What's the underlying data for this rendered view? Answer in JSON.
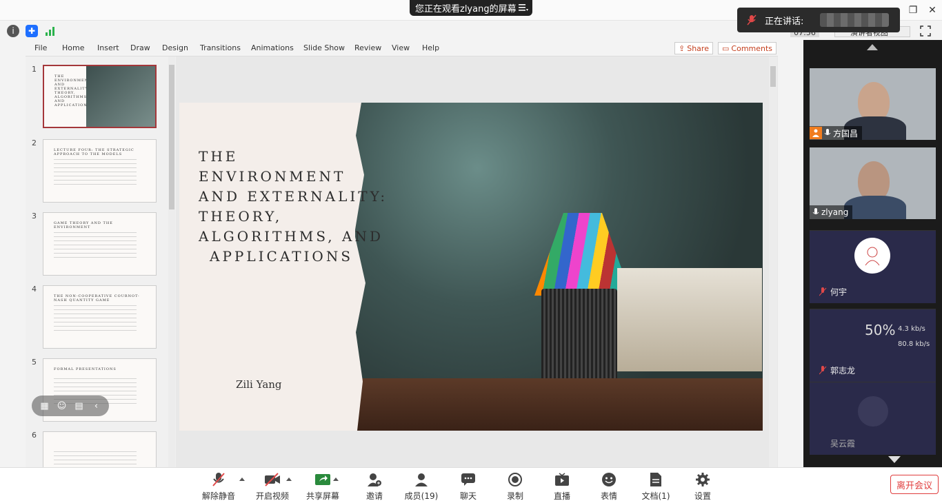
{
  "top": {
    "share_banner": "您正在观看zlyang的屏幕",
    "speaking_label": "正在讲话:",
    "clock": "07:56",
    "view_mode": "演讲者视图"
  },
  "ppt": {
    "tabs": [
      "File",
      "Home",
      "Insert",
      "Draw",
      "Design",
      "Transitions",
      "Animations",
      "Slide Show",
      "Review",
      "View",
      "Help"
    ],
    "share_label": "Share",
    "comments_label": "Comments",
    "thumbs": [
      {
        "num": "1",
        "title": "THE ENVIRONMENT AND EXTERNALITY: THEORY, ALGORITHMS, AND APPLICATIONS"
      },
      {
        "num": "2",
        "title": "LECTURE FOUR: THE STRATEGIC APPROACH TO THE MODELS"
      },
      {
        "num": "3",
        "title": "GAME THEORY AND THE ENVIRONMENT"
      },
      {
        "num": "4",
        "title": "THE NON-COOPERATIVE COURNOT-NASH QUANTITY GAME"
      },
      {
        "num": "5",
        "title": "FORMAL PRESENTATIONS"
      },
      {
        "num": "6",
        "title": ""
      }
    ],
    "slide": {
      "title_lines": [
        "THE",
        "ENVIRONMENT",
        "AND EXTERNALITY:",
        "THEORY,",
        "ALGORITHMS, AND",
        "APPLICATIONS"
      ],
      "author": "Zili Yang"
    }
  },
  "panel": {
    "videos": [
      {
        "name": "方国昌",
        "host": true
      },
      {
        "name": "zlyang",
        "host": false
      }
    ],
    "participants": [
      {
        "name": "何宇"
      },
      {
        "name": "郭志龙"
      },
      {
        "name": "吴云霞"
      }
    ],
    "net": {
      "percent": "50%",
      "up": "4.3",
      "down": "80.8",
      "unit": "kb/s"
    }
  },
  "toolbar": {
    "items": [
      {
        "label": "解除静音",
        "icon": "mic-muted-icon"
      },
      {
        "label": "开启视频",
        "icon": "camera-off-icon"
      },
      {
        "label": "共享屏幕",
        "icon": "share-screen-icon"
      },
      {
        "label": "邀请",
        "icon": "invite-icon"
      },
      {
        "label": "成员(19)",
        "icon": "members-icon"
      },
      {
        "label": "聊天",
        "icon": "chat-icon"
      },
      {
        "label": "录制",
        "icon": "record-icon"
      },
      {
        "label": "直播",
        "icon": "live-icon"
      },
      {
        "label": "表情",
        "icon": "emoji-icon"
      },
      {
        "label": "文档(1)",
        "icon": "document-icon"
      },
      {
        "label": "设置",
        "icon": "settings-icon"
      }
    ],
    "leave_label": "离开会议"
  },
  "colors": {
    "accent": "#1e6fff",
    "leave": "#e03c3c",
    "host": "#f07c1e",
    "ppt_accent": "#c43e1c"
  }
}
